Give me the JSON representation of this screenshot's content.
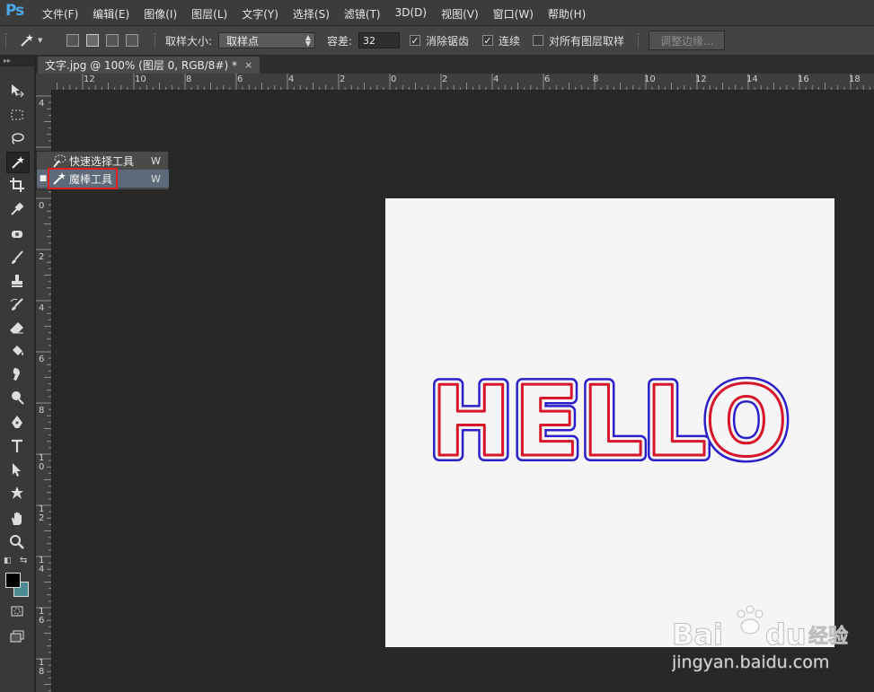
{
  "app": {
    "logo": "Ps"
  },
  "menu": [
    "文件(F)",
    "编辑(E)",
    "图像(I)",
    "图层(L)",
    "文字(Y)",
    "选择(S)",
    "滤镜(T)",
    "3D(D)",
    "视图(V)",
    "窗口(W)",
    "帮助(H)"
  ],
  "options": {
    "sample_size_label": "取样大小:",
    "sample_size_value": "取样点",
    "tolerance_label": "容差:",
    "tolerance_value": "32",
    "antialias_label": "消除锯齿",
    "antialias_checked": true,
    "contiguous_label": "连续",
    "contiguous_checked": true,
    "all_layers_label": "对所有图层取样",
    "all_layers_checked": false,
    "refine_edge_label": "调整边缘..."
  },
  "document": {
    "tab_title": "文字.jpg @ 100% (图层 0, RGB/8#) *",
    "tab_close": "×",
    "artwork_text": "HELLO"
  },
  "ruler": {
    "h_labels": [
      "12",
      "10",
      "8",
      "6",
      "4",
      "2",
      "0",
      "2",
      "4",
      "6",
      "8",
      "10",
      "12",
      "14",
      "16",
      "18"
    ],
    "v_labels": [
      "4",
      "2",
      "0",
      "2",
      "4",
      "6",
      "8",
      "10",
      "12",
      "14",
      "16",
      "18"
    ]
  },
  "flyout": {
    "items": [
      {
        "label": "快速选择工具",
        "shortcut": "W",
        "selected": false
      },
      {
        "label": "魔棒工具",
        "shortcut": "W",
        "selected": true
      }
    ]
  },
  "colors": {
    "foreground": "#000000",
    "background": "#4a8a90",
    "accent": "#e02020"
  },
  "watermark": {
    "brand": "Bai",
    "brand2": "du",
    "cn": "经验",
    "url": "jingyan.baidu.com"
  }
}
